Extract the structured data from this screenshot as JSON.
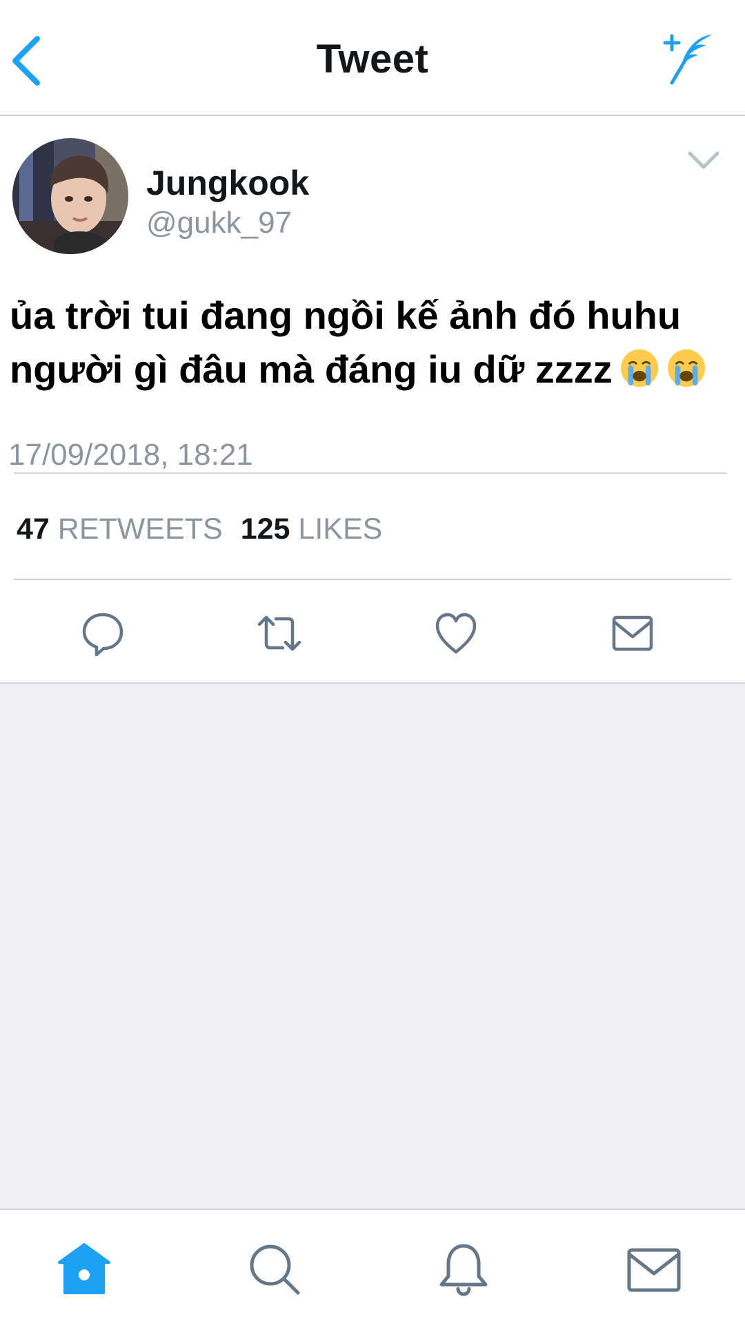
{
  "nav": {
    "title": "Tweet",
    "back_icon": "chevron-left-icon",
    "compose_icon": "compose-quill-icon"
  },
  "tweet": {
    "author_name": "Jungkook",
    "author_handle": "@gukk_97",
    "text_line_1": "ủa trời tui đang ngồi kế ảnh đó huhu",
    "text_line_2": "người gì đâu mà đáng iu dữ zzzz",
    "emoji": [
      "loudly-crying-face-emoji",
      "loudly-crying-face-emoji"
    ],
    "timestamp": "17/09/2018, 18:21",
    "retweets_count": "47",
    "retweets_label": "RETWEETS",
    "likes_count": "125",
    "likes_label": "LIKES"
  },
  "actions": [
    "reply-icon",
    "retweet-icon",
    "like-heart-icon",
    "direct-message-icon"
  ],
  "tabbar": {
    "tabs": [
      "home-icon",
      "search-icon",
      "notifications-bell-icon",
      "messages-envelope-icon"
    ],
    "active": "home-icon"
  },
  "colors": {
    "accent": "#1da1f2",
    "text": "#14171a",
    "secondary_text": "#8c959e",
    "icon": "#657786",
    "empty_background": "#efeff4"
  }
}
